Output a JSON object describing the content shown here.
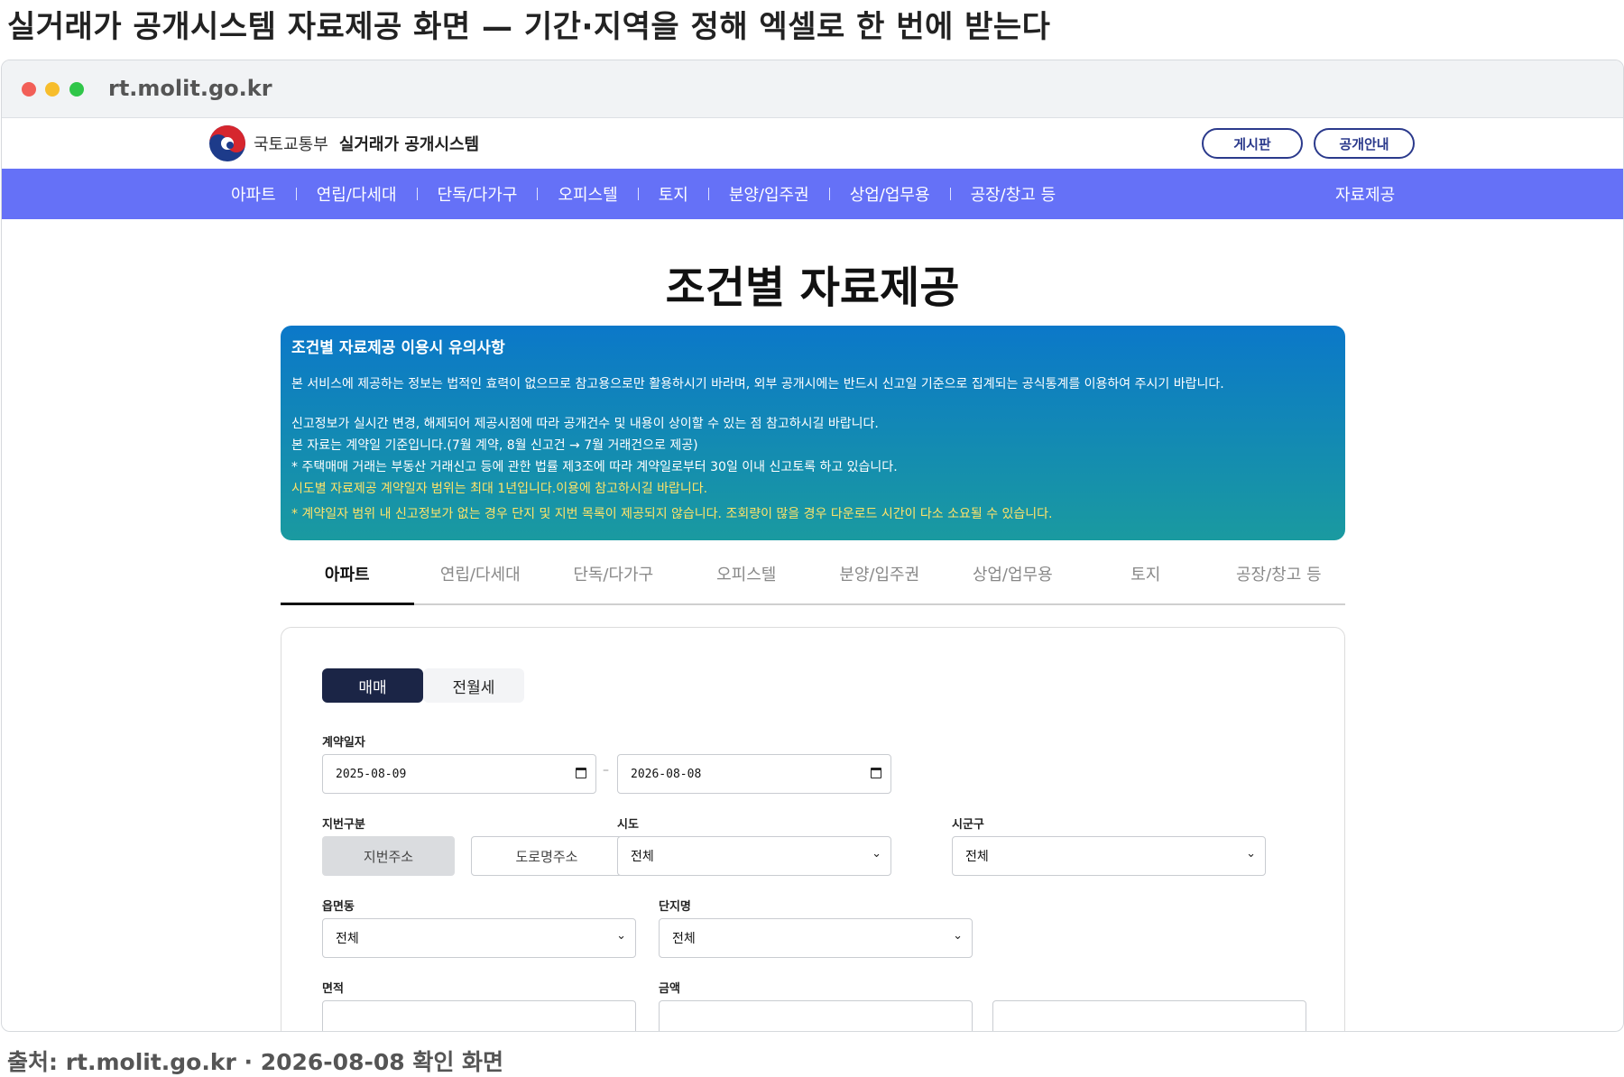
{
  "headline": "실거래가 공개시스템 자료제공 화면 — 기간·지역을 정해 엑셀로 한 번에 받는다",
  "browser": {
    "url": "rt.molit.go.kr"
  },
  "site": {
    "ministry": "국토교통부",
    "system_name": "실거래가 공개시스템",
    "buttons": [
      "게시판",
      "공개안내"
    ]
  },
  "nav": {
    "items": [
      "아파트",
      "연립/다세대",
      "단독/다가구",
      "오피스텔",
      "토지",
      "분양/입주권",
      "상업/업무용",
      "공장/창고 등"
    ],
    "right": "자료제공"
  },
  "page_title": "조건별 자료제공",
  "notice": {
    "title": "조건별 자료제공 이용시 유의사항",
    "lines": [
      "본 서비스에 제공하는 정보는 법적인 효력이 없으므로 참고용으로만 활용하시기 바라며, 외부 공개시에는 반드시 신고일 기준으로 집계되는 공식통계를 이용하여 주시기 바랍니다.",
      "신고정보가 실시간 변경, 해제되어 제공시점에 따라 공개건수 및 내용이 상이할 수 있는 점 참고하시길 바랍니다.",
      "본 자료는 계약일 기준입니다.(7월 계약, 8월 신고건 → 7월 거래건으로 제공)",
      "* 주택매매 거래는 부동산 거래신고 등에 관한 법률 제3조에 따라 계약일로부터 30일 이내 신고토록 하고 있습니다.",
      "시도별 자료제공 계약일자 범위는 최대 1년입니다.이용에 참고하시길 바랍니다.",
      "* 계약일자 범위 내 신고정보가 없는 경우 단지 및 지번 목록이 제공되지 않습니다. 조회량이 많을 경우 다운로드 시간이 다소 소요될 수 있습니다."
    ],
    "highlight_color": "#ffe36a"
  },
  "tabs": [
    "아파트",
    "연립/다세대",
    "단독/다가구",
    "오피스텔",
    "분양/입주권",
    "상업/업무용",
    "토지",
    "공장/창고 등"
  ],
  "active_tab": "아파트",
  "form": {
    "deal_types": [
      "매매",
      "전월세"
    ],
    "contract_date": {
      "label": "계약일자",
      "from": "2025-08-09",
      "to": "2026-08-08"
    },
    "lot_type": {
      "label": "지번구분",
      "options": [
        "지번주소",
        "도로명주소"
      ]
    },
    "sido": {
      "label": "시도",
      "value": "전체"
    },
    "sigungu": {
      "label": "시군구",
      "value": "전체"
    },
    "eupmyeondong": {
      "label": "읍면동",
      "value": "전체"
    },
    "complex": {
      "label": "단지명",
      "value": "전체"
    },
    "area": {
      "label": "면적"
    },
    "price": {
      "label": "금액"
    }
  },
  "caption": "출처: rt.molit.go.kr · 2026-08-08 확인 화면",
  "colors": {
    "nav": "#6571f7",
    "primary": "#1b2546",
    "accent": "#2b3a8c"
  }
}
